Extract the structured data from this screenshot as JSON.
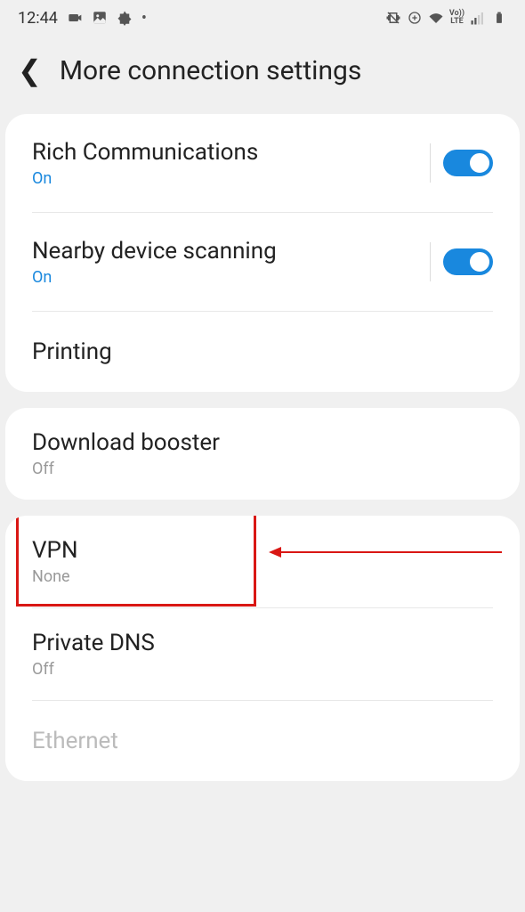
{
  "status": {
    "time": "12:44",
    "lte": "LTE",
    "vo": "Vo))"
  },
  "header": {
    "title": "More connection settings"
  },
  "sections": {
    "rich_comm": {
      "title": "Rich Communications",
      "status": "On"
    },
    "nearby": {
      "title": "Nearby device scanning",
      "status": "On"
    },
    "printing": {
      "title": "Printing"
    },
    "download": {
      "title": "Download booster",
      "status": "Off"
    },
    "vpn": {
      "title": "VPN",
      "status": "None"
    },
    "private_dns": {
      "title": "Private DNS",
      "status": "Off"
    },
    "ethernet": {
      "title": "Ethernet"
    }
  }
}
